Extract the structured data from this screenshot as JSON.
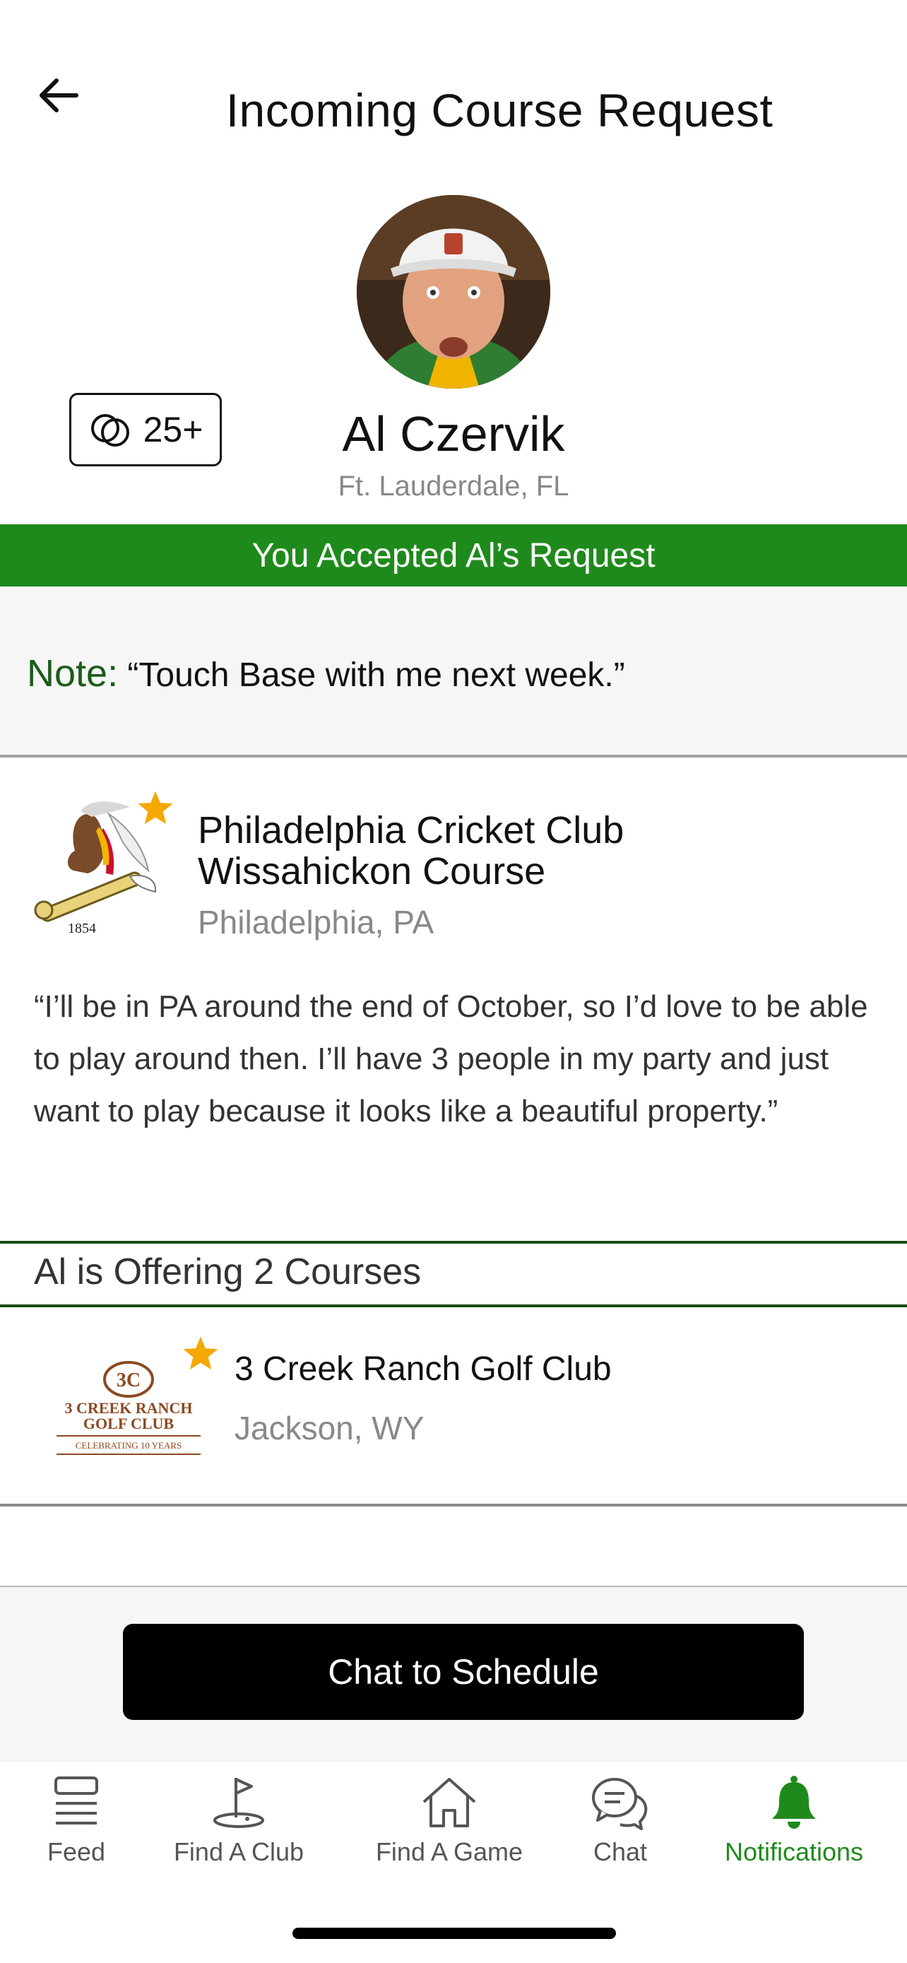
{
  "header": {
    "title": "Incoming Course Request",
    "back_icon": "arrow-left-icon"
  },
  "profile": {
    "name": "Al Czervik",
    "location": "Ft. Lauderdale, FL",
    "rounds_badge": "25+"
  },
  "status_banner": "You Accepted Al’s Request",
  "note": {
    "label": "Note:",
    "text": "“Touch Base with me next week.”"
  },
  "requested_course": {
    "name_line1": "Philadelphia Cricket Club",
    "name_line2": "Wissahickon Course",
    "location": "Philadelphia, PA",
    "logo_year": "1854",
    "message": "“I’ll be in PA around the end of October, so I’d love to be able to play around then. I’ll have 3 people in my party and just want to play because it looks like a beautiful property.”"
  },
  "offering": {
    "heading": "Al is Offering 2 Courses",
    "courses": [
      {
        "name": "3 Creek Ranch Golf Club",
        "location": "Jackson, WY",
        "logo_line1": "3 CREEK RANCH",
        "logo_line2": "GOLF CLUB",
        "logo_line3": "CELEBRATING 10 YEARS"
      }
    ]
  },
  "cta": {
    "label": "Chat to Schedule"
  },
  "tabs": [
    {
      "label": "Feed",
      "icon": "feed-icon"
    },
    {
      "label": "Find A Club",
      "icon": "golf-flag-icon"
    },
    {
      "label": "Find A Game",
      "icon": "home-icon"
    },
    {
      "label": "Chat",
      "icon": "chat-bubbles-icon"
    },
    {
      "label": "Notifications",
      "icon": "bell-icon",
      "active": true
    }
  ],
  "colors": {
    "accent_green": "#1f8a1c",
    "note_green": "#1a5c19",
    "star": "#f5a800"
  }
}
